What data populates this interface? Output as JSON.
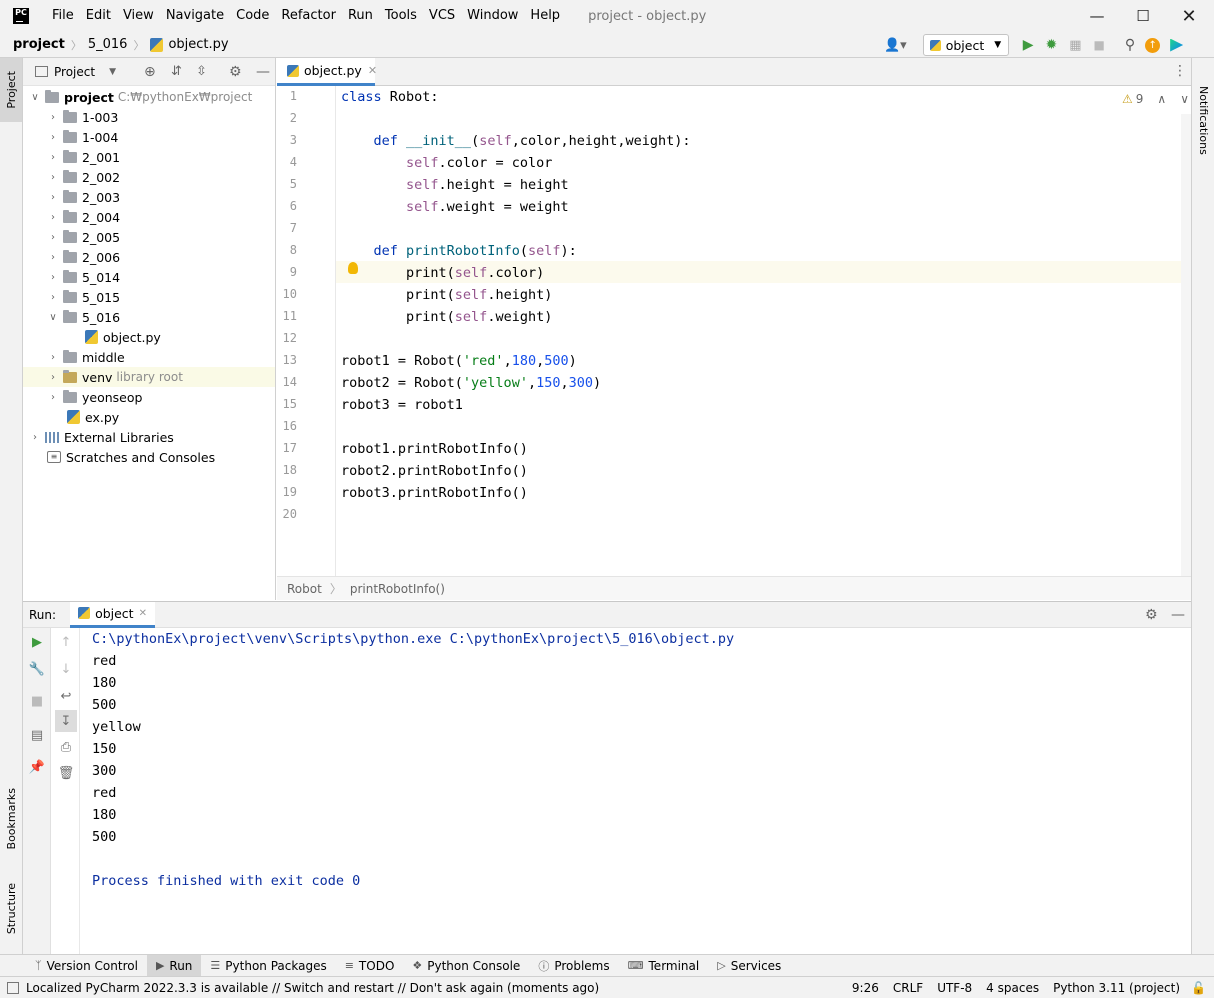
{
  "menu": {
    "items": [
      "File",
      "Edit",
      "View",
      "Navigate",
      "Code",
      "Refactor",
      "Run",
      "Tools",
      "VCS",
      "Window",
      "Help"
    ],
    "window_title": "project - object.py"
  },
  "logo": "PC",
  "nav": {
    "crumbs": [
      "project",
      "5_016",
      "object.py"
    ],
    "run_config": "object"
  },
  "left_tabs": {
    "project": "Project",
    "bookmarks": "Bookmarks",
    "structure": "Structure"
  },
  "right_tabs": {
    "notifications": "Notifications"
  },
  "project_panel": {
    "title": "Project",
    "root": {
      "name": "project",
      "path": "C:₩pythonEx₩project"
    },
    "items": [
      {
        "name": "1-003",
        "type": "folder"
      },
      {
        "name": "1-004",
        "type": "folder"
      },
      {
        "name": "2_001",
        "type": "folder"
      },
      {
        "name": "2_002",
        "type": "folder"
      },
      {
        "name": "2_003",
        "type": "folder"
      },
      {
        "name": "2_004",
        "type": "folder"
      },
      {
        "name": "2_005",
        "type": "folder"
      },
      {
        "name": "2_006",
        "type": "folder"
      },
      {
        "name": "5_014",
        "type": "folder"
      },
      {
        "name": "5_015",
        "type": "folder"
      },
      {
        "name": "5_016",
        "type": "folder"
      },
      {
        "name": "object.py",
        "type": "file"
      },
      {
        "name": "middle",
        "type": "folder"
      },
      {
        "name": "venv",
        "type": "folder",
        "note": "library root"
      },
      {
        "name": "yeonseop",
        "type": "folder"
      },
      {
        "name": "ex.py",
        "type": "file"
      },
      {
        "name": "External Libraries",
        "type": "lib"
      },
      {
        "name": "Scratches and Consoles",
        "type": "scratch"
      }
    ]
  },
  "editor": {
    "tab": "object.py",
    "warnings": "9",
    "line_numbers": [
      "1",
      "2",
      "3",
      "4",
      "5",
      "6",
      "7",
      "8",
      "9",
      "10",
      "11",
      "12",
      "13",
      "14",
      "15",
      "16",
      "17",
      "18",
      "19",
      "20"
    ],
    "code": {
      "l1a": "class",
      "l1b": " Robot:",
      "l3a": "    def ",
      "l3b": "__init__",
      "l3c": "(",
      "l3d": "self",
      "l3e": ",color,height,weight):",
      "l4a": "        ",
      "l4b": "self",
      "l4c": ".color = color",
      "l5a": "        ",
      "l5b": "self",
      "l5c": ".height = height",
      "l6a": "        ",
      "l6b": "self",
      "l6c": ".weight = weight",
      "l8a": "    def ",
      "l8b": "printRobotInfo",
      "l8c": "(",
      "l8d": "self",
      "l8e": "):",
      "l9a": "        print(",
      "l9b": "self",
      "l9c": ".color)",
      "l10a": "        print(",
      "l10b": "self",
      "l10c": ".height)",
      "l11a": "        print(",
      "l11b": "self",
      "l11c": ".weight)",
      "l13a": "robot1 = Robot(",
      "l13b": "'red'",
      "l13c": ",",
      "l13d": "180",
      "l13e": ",",
      "l13f": "500",
      "l13g": ")",
      "l14a": "robot2 = Robot(",
      "l14b": "'yellow'",
      "l14c": ",",
      "l14d": "150",
      "l14e": ",",
      "l14f": "300",
      "l14g": ")",
      "l15": "robot3 = robot1",
      "l17": "robot1.printRobotInfo()",
      "l18": "robot2.printRobotInfo()",
      "l19": "robot3.printRobotInfo()"
    },
    "breadcrumb": [
      "Robot",
      "printRobotInfo()"
    ]
  },
  "run_panel": {
    "label": "Run:",
    "tab": "object",
    "output": [
      "C:\\pythonEx\\project\\venv\\Scripts\\python.exe C:\\pythonEx\\project\\5_016\\object.py",
      "red",
      "180",
      "500",
      "yellow",
      "150",
      "300",
      "red",
      "180",
      "500",
      "",
      "Process finished with exit code 0"
    ]
  },
  "tool_windows": [
    "Version Control",
    "Run",
    "Python Packages",
    "TODO",
    "Python Console",
    "Problems",
    "Terminal",
    "Services"
  ],
  "status": {
    "message": "Localized PyCharm 2022.3.3 is available // Switch and restart // Don't ask again (moments ago)",
    "position": "9:26",
    "line_sep": "CRLF",
    "encoding": "UTF-8",
    "indent": "4 spaces",
    "interpreter": "Python 3.11 (project)"
  },
  "colors": {
    "accent": "#4083c9",
    "keyword": "#0033b3",
    "self": "#94558d",
    "string": "#067d17",
    "number": "#1750eb"
  }
}
